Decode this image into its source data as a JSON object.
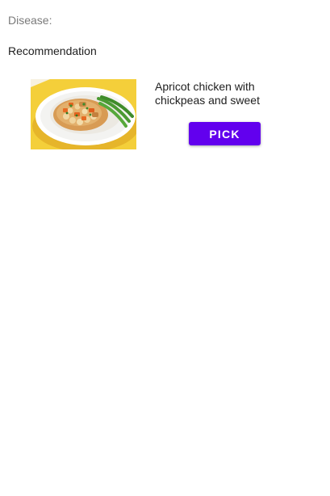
{
  "disease": {
    "label": "Disease:"
  },
  "recommendation": {
    "title": "Recommendation",
    "items": [
      {
        "name": "Apricot chicken with chickpeas and sweet",
        "image": "dish-photo",
        "action_label": "PICK"
      }
    ]
  },
  "colors": {
    "accent": "#6200ee",
    "label_gray": "#7a7a7a",
    "text": "#202020"
  }
}
